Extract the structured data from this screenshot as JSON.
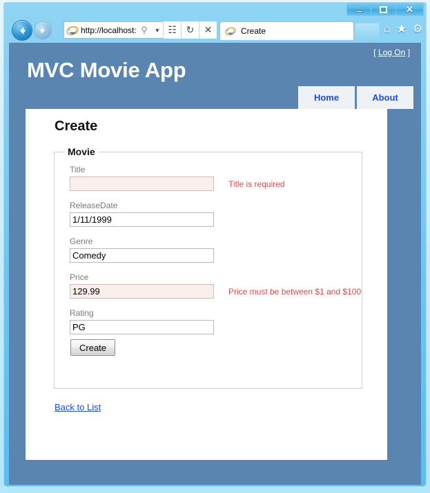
{
  "browser": {
    "window_controls": {
      "minimize": "minimize-button",
      "maximize": "maximize-button",
      "close": "✕"
    },
    "back_label": "←",
    "forward_label": "→",
    "address": {
      "url": "http://localhost:",
      "search_icon": "⚲",
      "dropdown_icon": "▼",
      "compat_icon": "☷",
      "refresh_icon": "↻",
      "stop_icon": "✕"
    },
    "tab": {
      "label": "Create"
    },
    "new_tab_label": "",
    "toolbar_icons": [
      {
        "name": "home-icon",
        "glyph": "⌂"
      },
      {
        "name": "favorites-icon",
        "glyph": "★"
      },
      {
        "name": "tools-icon",
        "glyph": "⚙"
      }
    ]
  },
  "site": {
    "title": "MVC Movie App",
    "logon_prefix": "[ ",
    "logon_label": "Log On",
    "logon_suffix": " ]",
    "nav": [
      {
        "label": "Home"
      },
      {
        "label": "About"
      }
    ]
  },
  "page": {
    "heading": "Create",
    "fieldset_legend": "Movie",
    "fields": [
      {
        "label": "Title",
        "value": "",
        "error": "Title is required",
        "has_error": true
      },
      {
        "label": "ReleaseDate",
        "value": "1/11/1999",
        "error": "",
        "has_error": false
      },
      {
        "label": "Genre",
        "value": "Comedy",
        "error": "",
        "has_error": false
      },
      {
        "label": "Price",
        "value": "129.99",
        "error": "Price must be between $1 and $100",
        "has_error": true
      },
      {
        "label": "Rating",
        "value": "PG",
        "error": "",
        "has_error": false
      }
    ],
    "submit_label": "Create",
    "back_link_label": "Back to List"
  },
  "colors": {
    "page_background": "#5a85b0",
    "content_background": "#ffffff",
    "link": "#1c49e8",
    "error_text": "#e84444",
    "error_field_bg": "#f9efeb",
    "label_text": "#7a7a7a"
  }
}
